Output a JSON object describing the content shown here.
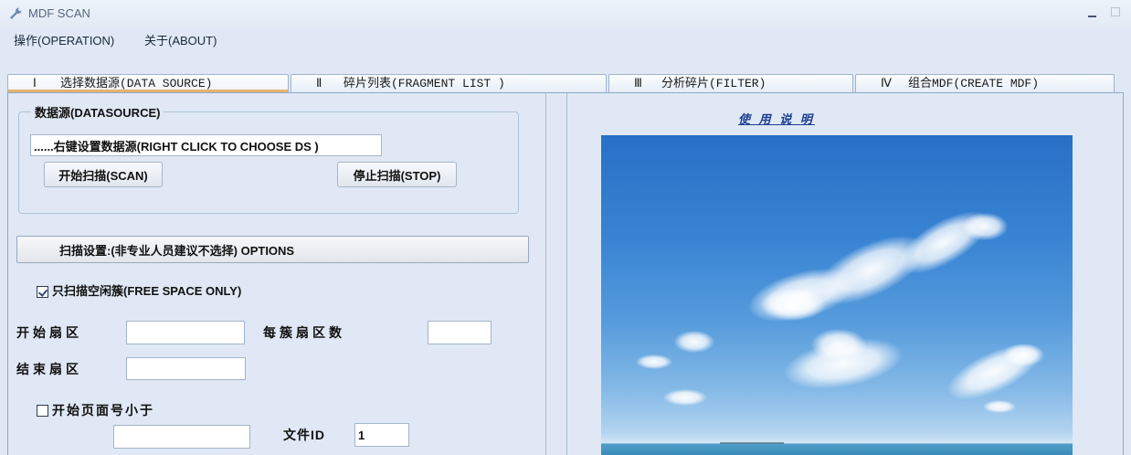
{
  "window": {
    "title": "MDF SCAN",
    "icon": "wrench-icon",
    "controls": {
      "minimize": "minimize-icon",
      "maximize": "maximize-icon"
    }
  },
  "menu": [
    {
      "label": "操作(OPERATION)"
    },
    {
      "label": "关于(ABOUT)"
    }
  ],
  "tabs": [
    {
      "numeral": "Ⅰ",
      "label": "选择数据源(DATA SOURCE)",
      "selected": true
    },
    {
      "numeral": "Ⅱ",
      "label": "碎片列表(FRAGMENT LIST )",
      "selected": false
    },
    {
      "numeral": "Ⅲ",
      "label": "分析碎片(FILTER)",
      "selected": false
    },
    {
      "numeral": "Ⅳ",
      "label": "组合MDF(CREATE MDF)",
      "selected": false
    }
  ],
  "datasource": {
    "group_label": "数据源(DATASOURCE)",
    "field_value": "......右键设置数据源(RIGHT CLICK TO CHOOSE DS )",
    "scan_button": "开始扫描(SCAN)",
    "stop_button": "停止扫描(STOP)"
  },
  "options": {
    "button_label": "扫描设置:(非专业人员建议不选择) OPTIONS",
    "free_space_only": {
      "label": "只扫描空闲簇(FREE SPACE ONLY)",
      "checked": true
    },
    "start_sector": {
      "label": "开始扇区",
      "value": ""
    },
    "sectors_per_cluster": {
      "label": "每簇扇区数",
      "value": ""
    },
    "end_sector": {
      "label": "结束扇区",
      "value": ""
    },
    "start_page_less_than": {
      "label": "开始页面号小于",
      "checked": false,
      "value": ""
    },
    "file_id": {
      "label": "文件ID",
      "value": "1"
    }
  },
  "help": {
    "link_label": "使 用 说 明"
  },
  "colors": {
    "tab_underline": "#e6b36e",
    "link": "#1c3f91",
    "window_bg": "#dfe8f4"
  }
}
